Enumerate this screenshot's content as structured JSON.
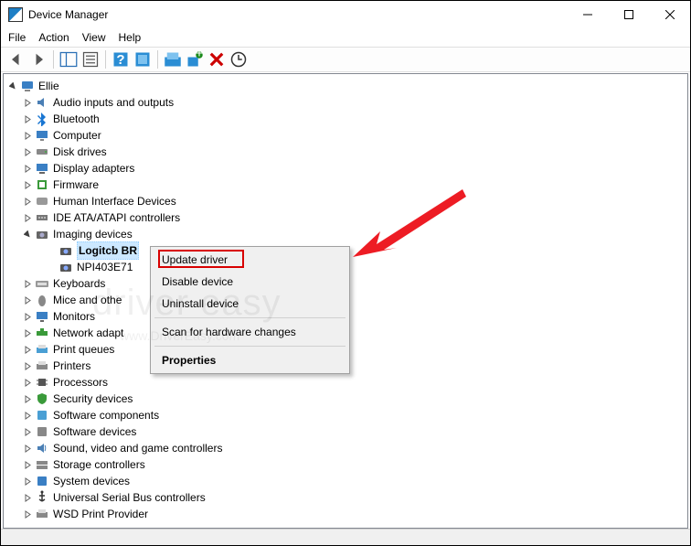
{
  "window": {
    "title": "Device Manager"
  },
  "menu": {
    "file": "File",
    "action": "Action",
    "view": "View",
    "help": "Help"
  },
  "tree": {
    "root": "Ellie",
    "nodes": [
      {
        "label": "Audio inputs and outputs",
        "icon": "audio"
      },
      {
        "label": "Bluetooth",
        "icon": "bluetooth"
      },
      {
        "label": "Computer",
        "icon": "computer"
      },
      {
        "label": "Disk drives",
        "icon": "disk"
      },
      {
        "label": "Display adapters",
        "icon": "display"
      },
      {
        "label": "Firmware",
        "icon": "firmware"
      },
      {
        "label": "Human Interface Devices",
        "icon": "hid"
      },
      {
        "label": "IDE ATA/ATAPI controllers",
        "icon": "ide"
      }
    ],
    "imaging": {
      "label": "Imaging devices",
      "children": [
        {
          "label": "Logitcb BR",
          "selected": true
        },
        {
          "label": "NPI403E71"
        }
      ]
    },
    "nodes2": [
      {
        "label": "Keyboards",
        "icon": "keyboard"
      },
      {
        "label": "Mice and othe",
        "icon": "mouse"
      },
      {
        "label": "Monitors",
        "icon": "monitor"
      },
      {
        "label": "Network adapt",
        "icon": "network"
      },
      {
        "label": "Print queues",
        "icon": "printqueue"
      },
      {
        "label": "Printers",
        "icon": "printer"
      },
      {
        "label": "Processors",
        "icon": "cpu"
      },
      {
        "label": "Security devices",
        "icon": "security"
      },
      {
        "label": "Software components",
        "icon": "swcomp"
      },
      {
        "label": "Software devices",
        "icon": "swdev"
      },
      {
        "label": "Sound, video and game controllers",
        "icon": "sound"
      },
      {
        "label": "Storage controllers",
        "icon": "storage"
      },
      {
        "label": "System devices",
        "icon": "system"
      },
      {
        "label": "Universal Serial Bus controllers",
        "icon": "usb"
      },
      {
        "label": "WSD Print Provider",
        "icon": "wsd"
      }
    ]
  },
  "context_menu": {
    "update": "Update driver",
    "disable": "Disable device",
    "uninstall": "Uninstall device",
    "scan": "Scan for hardware changes",
    "properties": "Properties"
  },
  "watermark": {
    "big": "driver easy",
    "small": "www.DriverEasy.com"
  }
}
